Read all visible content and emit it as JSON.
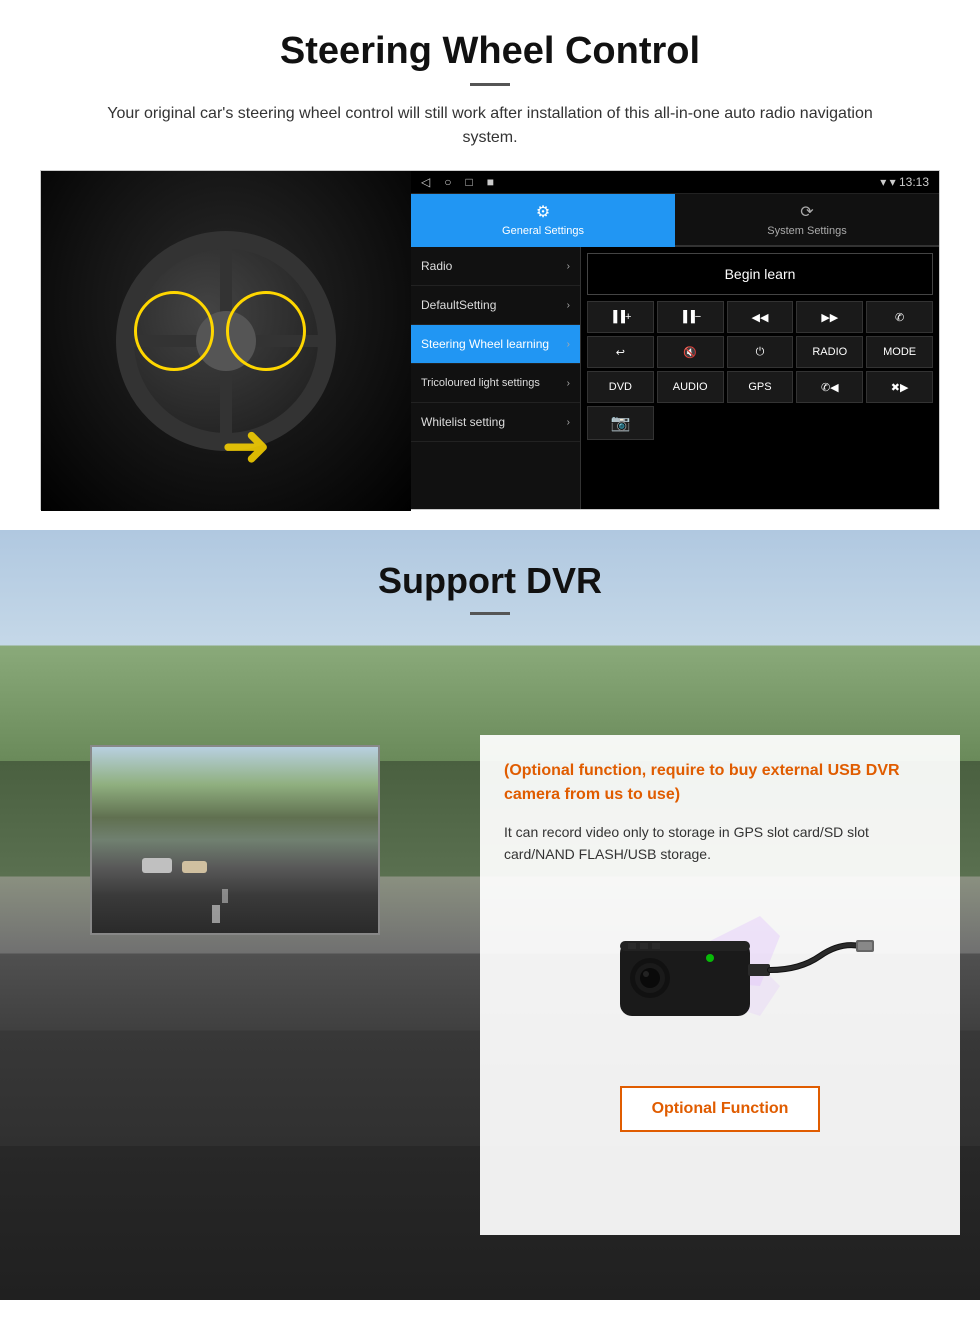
{
  "steering": {
    "title": "Steering Wheel Control",
    "subtitle": "Your original car's steering wheel control will still work after installation of this all-in-one auto radio navigation system.",
    "statusbar": {
      "nav": [
        "◁",
        "○",
        "□",
        "■"
      ],
      "time": "13:13",
      "signal": "▾"
    },
    "tabs": [
      {
        "label": "General Settings",
        "icon": "⚙",
        "active": true
      },
      {
        "label": "System Settings",
        "icon": "🔄",
        "active": false
      }
    ],
    "menu": [
      {
        "label": "Radio",
        "active": false
      },
      {
        "label": "DefaultSetting",
        "active": false
      },
      {
        "label": "Steering Wheel learning",
        "active": true
      },
      {
        "label": "Tricoloured light settings",
        "active": false
      },
      {
        "label": "Whitelist setting",
        "active": false
      }
    ],
    "begin_learn": "Begin learn",
    "controls": [
      {
        "label": "▐▐+",
        "row": 0
      },
      {
        "label": "▐▐−",
        "row": 0
      },
      {
        "label": "▐◀◀",
        "row": 0
      },
      {
        "label": "▶▶▐",
        "row": 0
      },
      {
        "label": "📞",
        "row": 0
      },
      {
        "label": "↩",
        "row": 1
      },
      {
        "label": "🔇",
        "row": 1
      },
      {
        "label": "⏻",
        "row": 1
      },
      {
        "label": "RADIO",
        "row": 1
      },
      {
        "label": "MODE",
        "row": 1
      },
      {
        "label": "DVD",
        "row": 2
      },
      {
        "label": "AUDIO",
        "row": 2
      },
      {
        "label": "GPS",
        "row": 2
      },
      {
        "label": "📞◀◀",
        "row": 2
      },
      {
        "label": "✖▶▶",
        "row": 2
      },
      {
        "label": "📷",
        "row": 3
      }
    ]
  },
  "dvr": {
    "title": "Support DVR",
    "optional_note": "(Optional function, require to buy external USB DVR camera from us to use)",
    "description": "It can record video only to storage in GPS slot card/SD slot card/NAND FLASH/USB storage.",
    "optional_function_label": "Optional Function"
  }
}
